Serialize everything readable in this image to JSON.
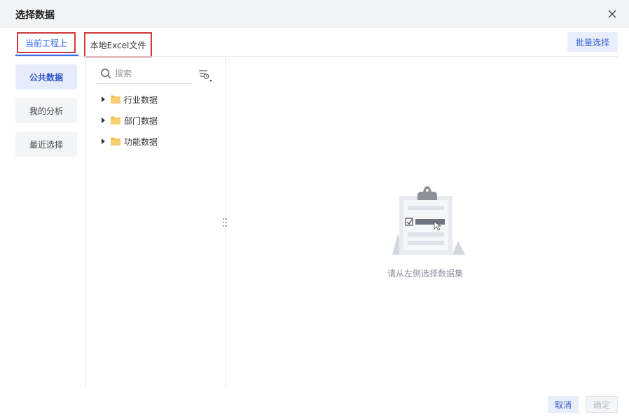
{
  "dialog": {
    "title": "选择数据"
  },
  "tabs": [
    {
      "label": "当前工程上",
      "active": true
    },
    {
      "label": "本地Excel文件",
      "active": false
    }
  ],
  "toolbar": {
    "batch_label": "批量选择"
  },
  "categories": [
    {
      "label": "公共数据",
      "active": true
    },
    {
      "label": "我的分析",
      "active": false
    },
    {
      "label": "最近选择",
      "active": false
    }
  ],
  "search": {
    "placeholder": "搜索",
    "value": ""
  },
  "tree": [
    {
      "label": "行业数据",
      "icon": "folder-icon"
    },
    {
      "label": "部门数据",
      "icon": "folder-icon"
    },
    {
      "label": "功能数据",
      "icon": "folder-icon"
    }
  ],
  "empty_state": {
    "text": "请从左侧选择数据集",
    "icon": "clipboard-illustration"
  },
  "footer": {
    "cancel_label": "取消",
    "ok_label": "确定"
  },
  "colors": {
    "accent": "#3b6cf0",
    "highlight_box": "#d0393a",
    "folder": "#f3c35a"
  }
}
